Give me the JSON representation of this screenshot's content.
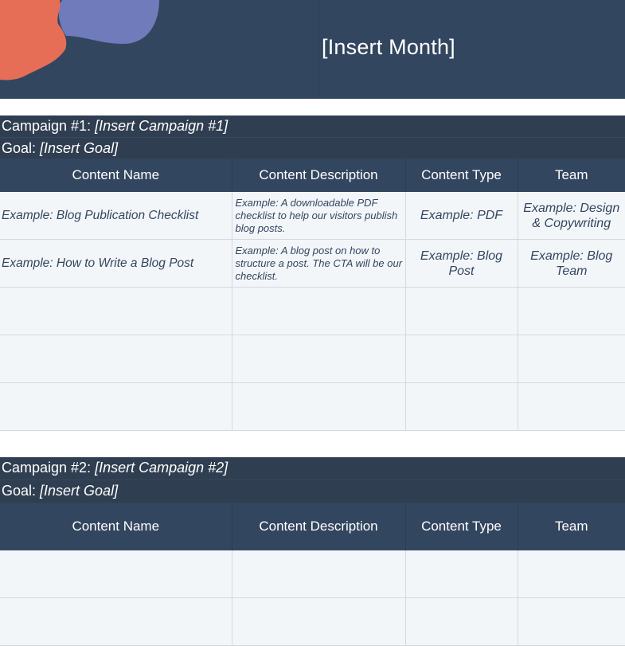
{
  "header": {
    "month": "[Insert Month]",
    "colors": {
      "background": "#33465f",
      "blob_orange": "#e66e56",
      "blob_purple": "#6f7bba"
    }
  },
  "columns": [
    "Content Name",
    "Content Description",
    "Content Type",
    "Team"
  ],
  "campaigns": [
    {
      "label": "Campaign #1: ",
      "name": "[Insert Campaign #1]",
      "goal_label": "Goal: ",
      "goal": "[Insert Goal]",
      "rows": [
        {
          "name": "Example: Blog Publication Checklist",
          "description": "Example: A downloadable PDF checklist to help our visitors publish blog posts.",
          "type": "Example: PDF",
          "team": "Example: Design & Copywriting"
        },
        {
          "name": "Example: How to Write a Blog Post",
          "description": "Example: A blog post on how to structure a post. The CTA will be our checklist.",
          "type": "Example: Blog Post",
          "team": "Example: Blog Team"
        },
        {
          "name": "",
          "description": "",
          "type": "",
          "team": ""
        },
        {
          "name": "",
          "description": "",
          "type": "",
          "team": ""
        },
        {
          "name": "",
          "description": "",
          "type": "",
          "team": ""
        }
      ]
    },
    {
      "label": "Campaign #2: ",
      "name": "[Insert Campaign #2]",
      "goal_label": "Goal: ",
      "goal": "[Insert Goal]",
      "rows": [
        {
          "name": "",
          "description": "",
          "type": "",
          "team": ""
        },
        {
          "name": "",
          "description": "",
          "type": "",
          "team": ""
        }
      ]
    }
  ]
}
